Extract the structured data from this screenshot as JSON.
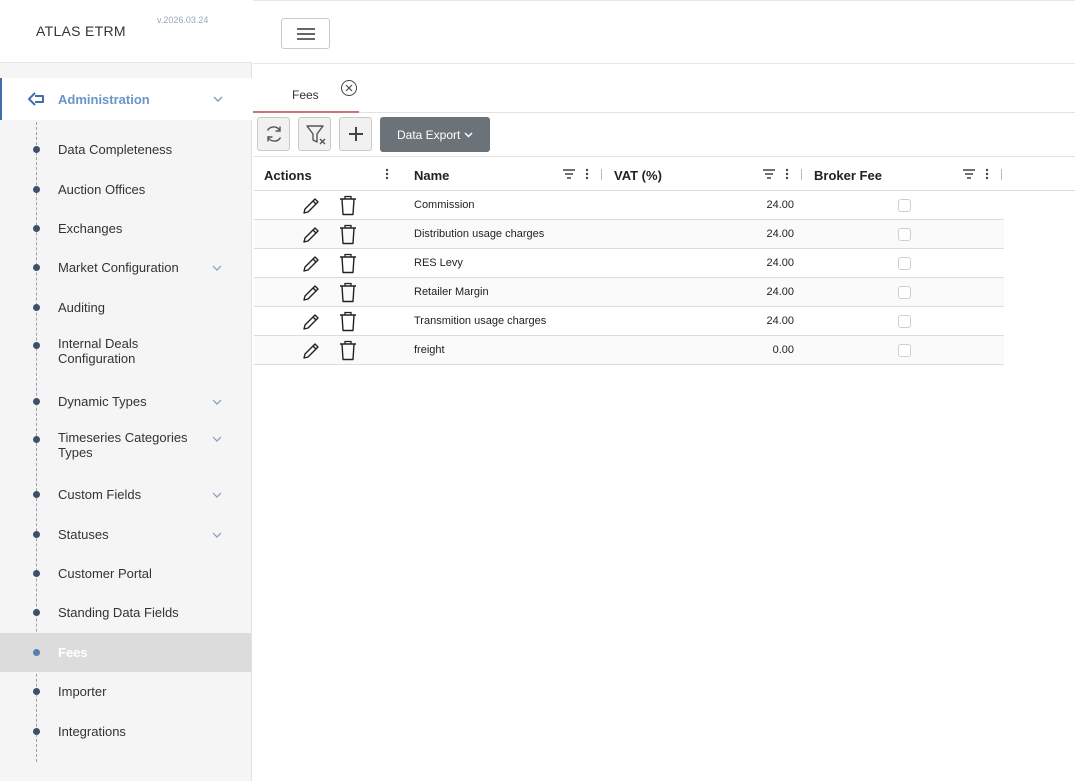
{
  "app": {
    "brand": "ATLAS ETRM",
    "version": "v.2026.03.24"
  },
  "sidebar": {
    "section": {
      "label": "Administration"
    },
    "items": [
      {
        "label": "Data Completeness",
        "has_children": false
      },
      {
        "label": "Auction Offices",
        "has_children": false
      },
      {
        "label": "Exchanges",
        "has_children": false
      },
      {
        "label": "Market Configuration",
        "has_children": true
      },
      {
        "label": "Auditing",
        "has_children": false
      },
      {
        "label": "Internal Deals Configuration",
        "has_children": false
      },
      {
        "label": "Dynamic Types",
        "has_children": true
      },
      {
        "label": "Timeseries Categories Types",
        "has_children": true
      },
      {
        "label": "Custom Fields",
        "has_children": true
      },
      {
        "label": "Statuses",
        "has_children": true
      },
      {
        "label": "Customer Portal",
        "has_children": false
      },
      {
        "label": "Standing Data Fields",
        "has_children": false
      },
      {
        "label": "Fees",
        "has_children": false,
        "active": true
      },
      {
        "label": "Importer",
        "has_children": false
      },
      {
        "label": "Integrations",
        "has_children": false
      }
    ]
  },
  "tabs": [
    {
      "label": "Fees",
      "active": true
    }
  ],
  "toolbar": {
    "refresh_icon": "refresh-icon",
    "clear_filter_icon": "filter-clear-icon",
    "add_icon": "plus-icon",
    "export_label": "Data Export"
  },
  "grid": {
    "columns": [
      {
        "key": "actions",
        "label": "Actions"
      },
      {
        "key": "name",
        "label": "Name"
      },
      {
        "key": "vat",
        "label": "VAT (%)"
      },
      {
        "key": "broker_fee",
        "label": "Broker Fee"
      }
    ],
    "rows": [
      {
        "name": "Commission",
        "vat": "24.00",
        "broker_fee": false
      },
      {
        "name": "Distribution usage charges",
        "vat": "24.00",
        "broker_fee": false
      },
      {
        "name": "RES Levy",
        "vat": "24.00",
        "broker_fee": false
      },
      {
        "name": "Retailer Margin",
        "vat": "24.00",
        "broker_fee": false
      },
      {
        "name": "Transmition usage charges",
        "vat": "24.00",
        "broker_fee": false
      },
      {
        "name": "freight",
        "vat": "0.00",
        "broker_fee": false
      }
    ]
  },
  "colors": {
    "accent": "#3e6fa8",
    "section_label": "#6a95c6",
    "active_bg": "#dcdcdc",
    "tab_underline": "#c7777a",
    "export_button": "#6b7278"
  }
}
